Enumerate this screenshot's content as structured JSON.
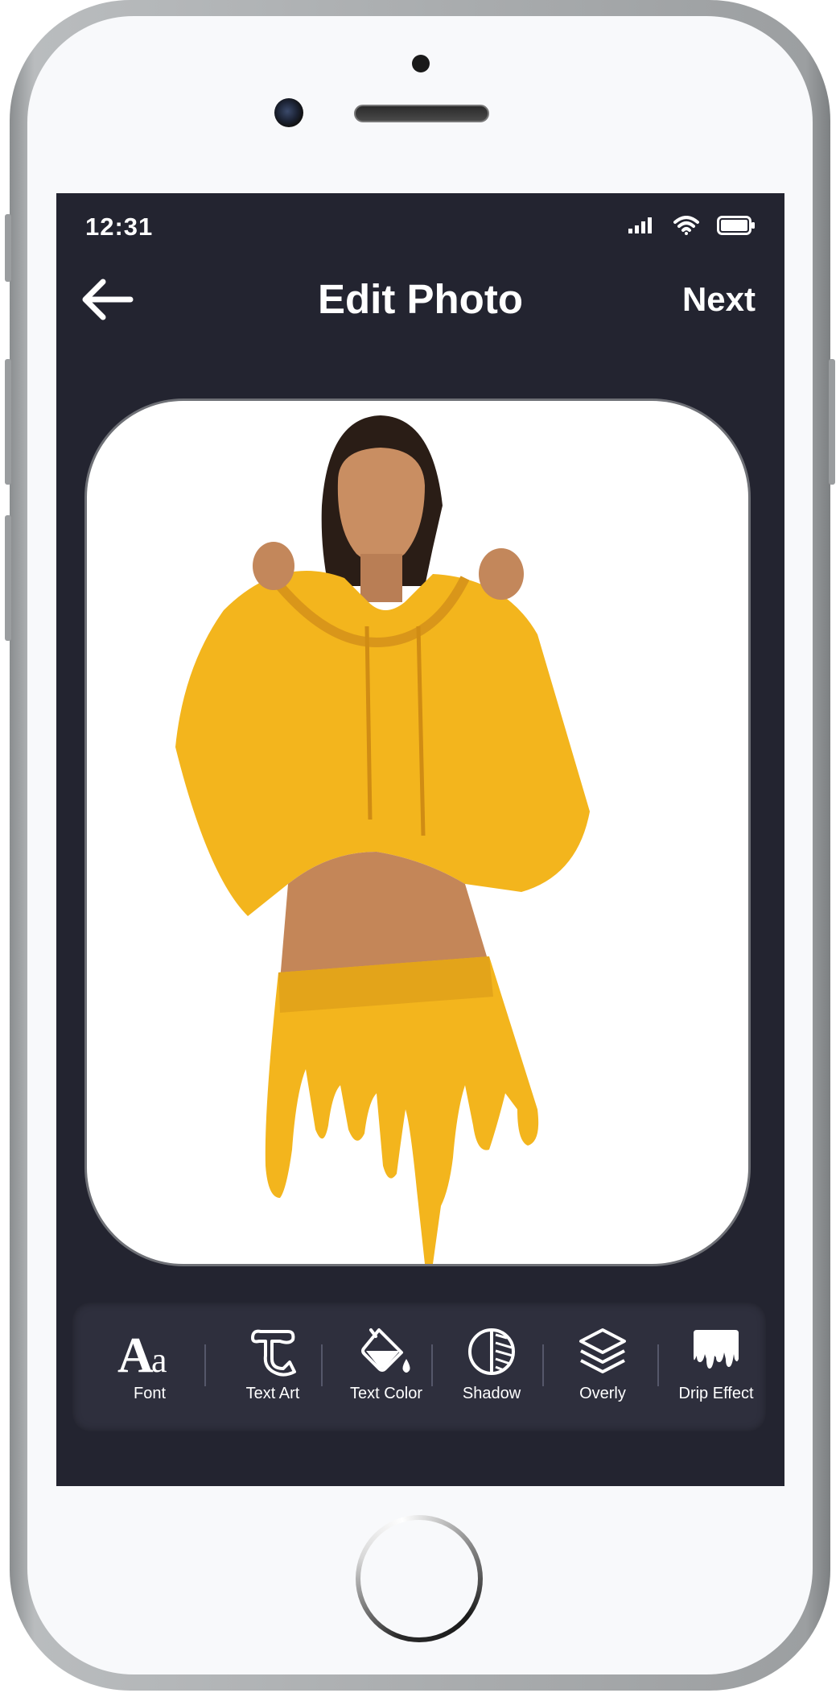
{
  "status_bar": {
    "time": "12:31",
    "icons": [
      "signal-icon",
      "wifi-icon",
      "battery-icon"
    ]
  },
  "header": {
    "back_icon": "arrow-left-icon",
    "title": "Edit Photo",
    "next_label": "Next"
  },
  "photo": {
    "description_icon": "edited-photo-yellow-drip"
  },
  "toolbar": {
    "items": [
      {
        "label": "Font",
        "icon": "font-icon"
      },
      {
        "label": "Text Art",
        "icon": "text-art-icon"
      },
      {
        "label": "Text Color",
        "icon": "paint-bucket-icon"
      },
      {
        "label": "Shadow",
        "icon": "shadow-icon"
      },
      {
        "label": "Overly",
        "icon": "layers-icon"
      },
      {
        "label": "Drip Effect",
        "icon": "drip-effect-icon"
      }
    ]
  },
  "colors": {
    "screen_bg": "#232430",
    "toolbar_bg": "#2e2f3d",
    "accent_yellow": "#f5b820",
    "text": "#ffffff"
  }
}
